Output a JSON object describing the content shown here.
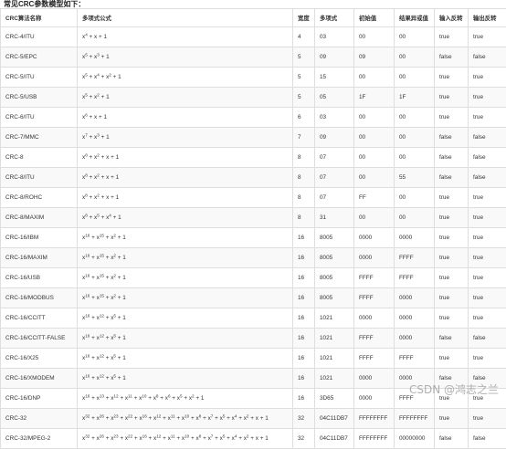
{
  "caption": "常见CRC参数模型如下：",
  "columns": [
    "CRC算法名称",
    "多项式公式",
    "宽度",
    "多项式",
    "初始值",
    "结果异或值",
    "输入反转",
    "输出反转"
  ],
  "rows": [
    {
      "name": "CRC-4/ITU",
      "formula": "x^{4} + x + 1",
      "width": "4",
      "poly": "03",
      "init": "00",
      "xorout": "00",
      "refin": "true",
      "refout": "true"
    },
    {
      "name": "CRC-5/EPC",
      "formula": "x^{5} + x^{3} + 1",
      "width": "5",
      "poly": "09",
      "init": "09",
      "xorout": "00",
      "refin": "false",
      "refout": "false"
    },
    {
      "name": "CRC-5/ITU",
      "formula": "x^{5} + x^{4} + x^{2} + 1",
      "width": "5",
      "poly": "15",
      "init": "00",
      "xorout": "00",
      "refin": "true",
      "refout": "true"
    },
    {
      "name": "CRC-5/USB",
      "formula": "x^{5} + x^{2} + 1",
      "width": "5",
      "poly": "05",
      "init": "1F",
      "xorout": "1F",
      "refin": "true",
      "refout": "true"
    },
    {
      "name": "CRC-6/ITU",
      "formula": "x^{6} + x + 1",
      "width": "6",
      "poly": "03",
      "init": "00",
      "xorout": "00",
      "refin": "true",
      "refout": "true"
    },
    {
      "name": "CRC-7/MMC",
      "formula": "x^{7} + x^{3} + 1",
      "width": "7",
      "poly": "09",
      "init": "00",
      "xorout": "00",
      "refin": "false",
      "refout": "false"
    },
    {
      "name": "CRC-8",
      "formula": "x^{8} + x^{2} + x + 1",
      "width": "8",
      "poly": "07",
      "init": "00",
      "xorout": "00",
      "refin": "false",
      "refout": "false"
    },
    {
      "name": "CRC-8/ITU",
      "formula": "x^{8} + x^{2} + x + 1",
      "width": "8",
      "poly": "07",
      "init": "00",
      "xorout": "55",
      "refin": "false",
      "refout": "false"
    },
    {
      "name": "CRC-8/ROHC",
      "formula": "x^{8} + x^{2} + x + 1",
      "width": "8",
      "poly": "07",
      "init": "FF",
      "xorout": "00",
      "refin": "true",
      "refout": "true"
    },
    {
      "name": "CRC-8/MAXIM",
      "formula": "x^{8} + x^{5} + x^{4} + 1",
      "width": "8",
      "poly": "31",
      "init": "00",
      "xorout": "00",
      "refin": "true",
      "refout": "true"
    },
    {
      "name": "CRC-16/IBM",
      "formula": "x^{16} + x^{15} + x^{2} + 1",
      "width": "16",
      "poly": "8005",
      "init": "0000",
      "xorout": "0000",
      "refin": "true",
      "refout": "true"
    },
    {
      "name": "CRC-16/MAXIM",
      "formula": "x^{16} + x^{15} + x^{2} + 1",
      "width": "16",
      "poly": "8005",
      "init": "0000",
      "xorout": "FFFF",
      "refin": "true",
      "refout": "true"
    },
    {
      "name": "CRC-16/USB",
      "formula": "x^{16} + x^{15} + x^{2} + 1",
      "width": "16",
      "poly": "8005",
      "init": "FFFF",
      "xorout": "FFFF",
      "refin": "true",
      "refout": "true"
    },
    {
      "name": "CRC-16/MODBUS",
      "formula": "x^{16} + x^{15} + x^{2} + 1",
      "width": "16",
      "poly": "8005",
      "init": "FFFF",
      "xorout": "0000",
      "refin": "true",
      "refout": "true"
    },
    {
      "name": "CRC-16/CCITT",
      "formula": "x^{16} + x^{12} + x^{5} + 1",
      "width": "16",
      "poly": "1021",
      "init": "0000",
      "xorout": "0000",
      "refin": "true",
      "refout": "true"
    },
    {
      "name": "CRC-16/CCITT-FALSE",
      "formula": "x^{16} + x^{12} + x^{5} + 1",
      "width": "16",
      "poly": "1021",
      "init": "FFFF",
      "xorout": "0000",
      "refin": "false",
      "refout": "false"
    },
    {
      "name": "CRC-16/X25",
      "formula": "x^{16} + x^{12} + x^{5} + 1",
      "width": "16",
      "poly": "1021",
      "init": "FFFF",
      "xorout": "FFFF",
      "refin": "true",
      "refout": "true"
    },
    {
      "name": "CRC-16/XMODEM",
      "formula": "x^{16} + x^{12} + x^{5} + 1",
      "width": "16",
      "poly": "1021",
      "init": "0000",
      "xorout": "0000",
      "refin": "false",
      "refout": "false"
    },
    {
      "name": "CRC-16/DNP",
      "formula": "x^{16} + x^{13} + x^{12} + x^{11} + x^{10} + x^{8} + x^{6} + x^{5} + x^{2} + 1",
      "width": "16",
      "poly": "3D65",
      "init": "0000",
      "xorout": "FFFF",
      "refin": "true",
      "refout": "true"
    },
    {
      "name": "CRC-32",
      "formula": "x^{32} + x^{26} + x^{23} + x^{22} + x^{16} + x^{12} + x^{11} + x^{10} + x^{8} + x^{7} + x^{5} + x^{4} + x^{2} + x + 1",
      "width": "32",
      "poly": "04C11DB7",
      "init": "FFFFFFFF",
      "xorout": "FFFFFFFF",
      "refin": "true",
      "refout": "true"
    },
    {
      "name": "CRC-32/MPEG-2",
      "formula": "x^{32} + x^{26} + x^{23} + x^{22} + x^{16} + x^{12} + x^{11} + x^{10} + x^{8} + x^{7} + x^{5} + x^{4} + x^{2} + x + 1",
      "width": "32",
      "poly": "04C11DB7",
      "init": "FFFFFFFF",
      "xorout": "00000000",
      "refin": "false",
      "refout": "false"
    }
  ],
  "watermark": "CSDN @鸿志之兰",
  "colors": {
    "border": "#dedede",
    "stripe": "#f9f9f9",
    "text": "#333333"
  }
}
